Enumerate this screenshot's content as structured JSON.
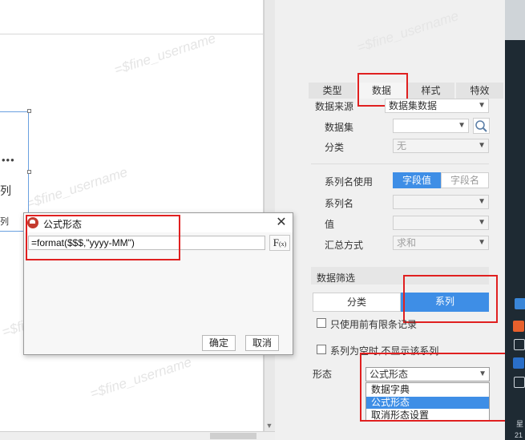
{
  "watermark": "=$fine_username",
  "canvas": {
    "frag_dots": "•••",
    "frag_lie": "列",
    "frag_small": "列"
  },
  "dialog": {
    "title": "公式形态",
    "formula": "=format($$$,\"yyyy-MM\")",
    "fx_label": "F",
    "fx_sub": "(x)",
    "ok": "确定",
    "cancel": "取消",
    "close": "✕"
  },
  "panel": {
    "tabs": [
      {
        "label": "类型"
      },
      {
        "label": "数据"
      },
      {
        "label": "样式"
      },
      {
        "label": "特效"
      }
    ],
    "data_source": {
      "label": "数据来源",
      "value": "数据集数据"
    },
    "dataset": {
      "label": "数据集",
      "value": ""
    },
    "category": {
      "label": "分类",
      "value": "无"
    },
    "series_name_use": {
      "label": "系列名使用",
      "options": [
        "字段值",
        "字段名"
      ]
    },
    "series_name": {
      "label": "系列名",
      "value": ""
    },
    "value": {
      "label": "值",
      "value": ""
    },
    "summary": {
      "label": "汇总方式",
      "value": "求和"
    },
    "filter": {
      "label": "数据筛选",
      "tabs": [
        "分类",
        "系列"
      ],
      "limit_label": "只使用前有限条记录",
      "hide_null_label": "系列为空时,不显示该系列"
    },
    "form": {
      "label": "形态",
      "value": "公式形态",
      "options": [
        "数据字典",
        "公式形态",
        "取消形态设置"
      ]
    }
  },
  "taskbar": {
    "label1": "星",
    "label2": "21"
  },
  "colors": {
    "accent": "#3e8ee6",
    "highlight": "#e02020"
  }
}
